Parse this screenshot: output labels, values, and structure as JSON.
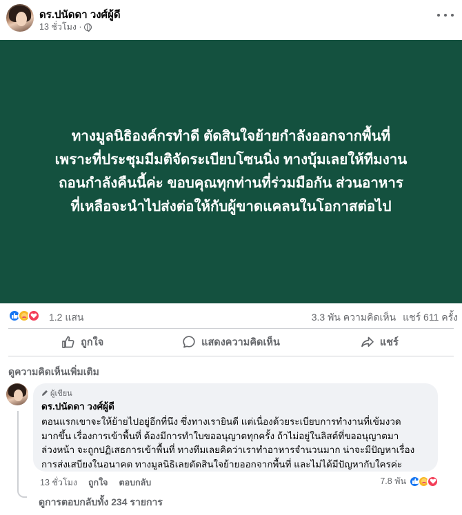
{
  "post": {
    "author": "ดร.ปนัดดา วงศ์ผู้ดี",
    "time": "13 ชั่วโมง ·",
    "privacy_icon": "globe-icon",
    "banner_bg": "#14513f",
    "banner_lines": [
      "ทางมูลนิธิองค์กรทำดี ตัดสินใจย้ายกำลังออกจากพื้นที่",
      "เพราะที่ประชุมมีมติจัดระเบียบโซนนิ่ง ทางบุ้มเลยให้ทีมงาน",
      "ถอนกำลังคืนนี้ค่ะ ขอบคุณทุกท่านที่ร่วมมือกัน ส่วนอาหาร",
      "ที่เหลือจะนำไปส่งต่อให้กับผู้ขาดแคลนในโอกาสต่อไป"
    ]
  },
  "stats": {
    "reactions": "1.2 แสน",
    "comments": "3.3 พัน ความคิดเห็น",
    "shares": "แชร์ 611 ครั้ง"
  },
  "actions": {
    "like": "ถูกใจ",
    "comment": "แสดงความคิดเห็น",
    "share": "แชร์"
  },
  "comments_section": {
    "more_comments": "ดูความคิดเห็นเพิ่มเติม",
    "comment": {
      "badge": "ผู้เขียน",
      "author": "ดร.ปนัดดา วงศ์ผู้ดี",
      "lines": [
        "ตอนแรกเขาจะให้ย้ายไปอยู่อีกที่นึง ซึ่งทางเรายินดี แต่เนื่องด้วยระเบียบการทำงานที่เข้มงวด",
        "มากขึ้น เรื่องการเข้าพื้นที่ ต้องมีการทำใบขออนุญาตทุกครั้ง ถ้าไม่อยู่ในลิสต์ที่ขออนุญาตมา",
        "ล่วงหน้า จะถูกปฏิเสธการเข้าพื้นที่ ทางทีมเลยคิดว่าเราทำอาหารจำนวนมาก น่าจะมีปัญหาเรื่อง",
        "การส่งเสบียงในอนาคต ทางมูลนิธิเลยตัดสินใจย้ายออกจากพื้นที่ และไม่ได้มีปัญหากับใครค่ะ"
      ],
      "time": "13 ชั่วโมง",
      "like": "ถูกใจ",
      "reply": "ตอบกลับ",
      "reaction_count": "7.8 พัน"
    },
    "view_replies": "ดูการตอบกลับทั้ง 234 รายการ"
  },
  "colors": {
    "like": "#1877f2",
    "care": "#f7b928",
    "love": "#f33e58"
  }
}
